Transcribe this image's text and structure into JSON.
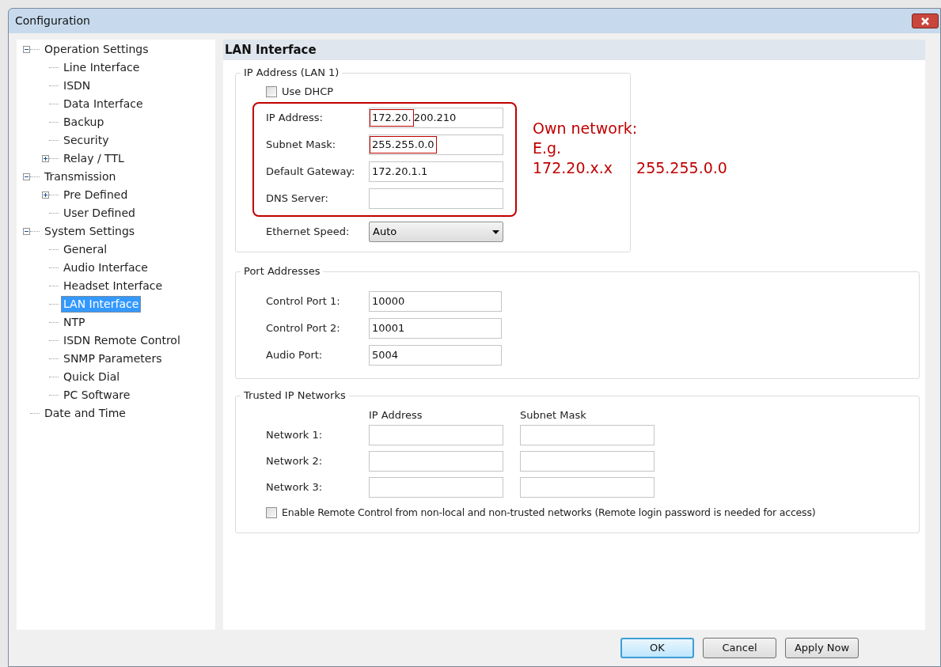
{
  "window": {
    "title": "Configuration"
  },
  "tree": [
    {
      "label": "Operation Settings",
      "expanded": true,
      "selected": false,
      "children": [
        {
          "label": "Line Interface",
          "selected": false
        },
        {
          "label": "ISDN",
          "selected": false
        },
        {
          "label": "Data Interface",
          "selected": false
        },
        {
          "label": "Backup",
          "selected": false
        },
        {
          "label": "Security",
          "selected": false
        },
        {
          "label": "Relay / TTL",
          "expanded": false,
          "selected": false
        }
      ]
    },
    {
      "label": "Transmission",
      "expanded": true,
      "selected": false,
      "children": [
        {
          "label": "Pre Defined",
          "expanded": false,
          "selected": false
        },
        {
          "label": "User Defined",
          "selected": false
        }
      ]
    },
    {
      "label": "System Settings",
      "expanded": true,
      "selected": false,
      "children": [
        {
          "label": "General",
          "selected": false
        },
        {
          "label": "Audio Interface",
          "selected": false
        },
        {
          "label": "Headset Interface",
          "selected": false
        },
        {
          "label": "LAN Interface",
          "selected": true
        },
        {
          "label": "NTP",
          "selected": false
        },
        {
          "label": "ISDN Remote Control",
          "selected": false
        },
        {
          "label": "SNMP Parameters",
          "selected": false
        },
        {
          "label": "Quick Dial",
          "selected": false
        },
        {
          "label": "PC Software",
          "selected": false
        }
      ]
    },
    {
      "label": "Date and Time",
      "selected": false
    }
  ],
  "panel": {
    "title": "LAN Interface",
    "ip_group": {
      "title": "IP Address (LAN 1)",
      "use_dhcp": {
        "label": "Use DHCP",
        "checked": false
      },
      "fields": [
        {
          "label": "IP Address:",
          "segments": [
            {
              "text": "172.20.",
              "marked": true
            },
            {
              "text": "200.210",
              "marked": false
            }
          ]
        },
        {
          "label": "Subnet Mask:",
          "segments": [
            {
              "text": "255.255.0.0",
              "marked": true
            }
          ]
        },
        {
          "label": "Default Gateway:",
          "segments": [
            {
              "text": "172.20.1.1",
              "marked": false
            }
          ]
        },
        {
          "label": "DNS Server:"
        }
      ],
      "ethernet_speed": {
        "label": "Ethernet Speed:",
        "value": "Auto"
      }
    },
    "annotation": {
      "lines": [
        "Own network:",
        "E.g."
      ],
      "examples": [
        "172.20.x.x",
        "255.255.0.0"
      ]
    },
    "port_group": {
      "title": "Port Addresses",
      "fields": [
        {
          "label": "Control Port 1:",
          "value": "10000"
        },
        {
          "label": "Control Port 2:",
          "value": "10001"
        },
        {
          "label": "Audio Port:",
          "value": "5004"
        }
      ]
    },
    "trusted_group": {
      "title": "Trusted IP Networks",
      "columns": [
        "IP Address",
        "Subnet Mask"
      ],
      "rows": [
        {
          "label": "Network 1:"
        },
        {
          "label": "Network 2:"
        },
        {
          "label": "Network 3:"
        }
      ],
      "remote": {
        "label": "Enable Remote Control from non-local and non-trusted networks (Remote login password is needed for access)",
        "checked": false
      }
    }
  },
  "buttons": [
    {
      "label": "OK",
      "default": true
    },
    {
      "label": "Cancel",
      "default": false
    },
    {
      "label": "Apply Now",
      "default": false
    }
  ]
}
